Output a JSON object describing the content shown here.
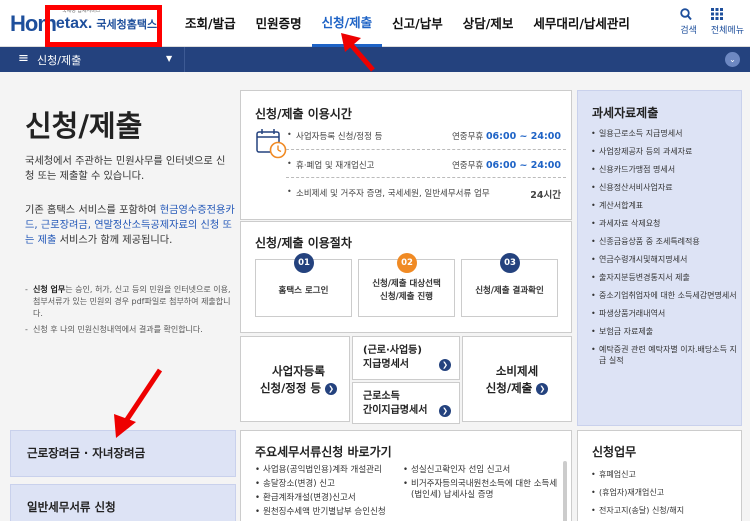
{
  "header": {
    "logo_home": "Hom",
    "logo_tax": "etax.",
    "logo_kr": "국세청홈택스",
    "logo_small": "국세청 납세서비스",
    "nav": [
      "조회/발급",
      "민원증명",
      "신청/제출",
      "신고/납부",
      "상담/제보",
      "세무대리/납세관리"
    ],
    "nav_active_index": 2,
    "search_label": "검색",
    "menu_label": "전체메뉴",
    "search_icon": "magnifier-icon",
    "menu_icon": "grid-icon"
  },
  "bar": {
    "title": "신청/제출",
    "home_icon": "hamburger-icon",
    "dropdown_icon": "triangle-down-icon",
    "right_icon": "chevron-down-icon"
  },
  "left": {
    "title": "신청/제출",
    "desc1": "국세청에서 주관하는 민원사무를 인터넷으로 신청 또는 제출할 수 있습니다.",
    "desc2_pre": "기존 홈택스 서비스를 포함하여 ",
    "desc2_link": "현금영수증전용카드, 근로장려금, 연말정산소득공제자료의 신청 또는 제출",
    "desc2_post": " 서비스가 함께 제공됩니다.",
    "note1_bold": "신청 업무",
    "note1": "는 승인, 허가, 신고 등의 민원을 인터넷으로 이용, 첨부서류가 있는 민원의 경우 pdf파일로 첨부하여 제출합니다.",
    "note2": "신청 후 나의 민원신청내역에서 결과를 확인합니다.",
    "btn1": "근로장려금 · 자녀장려금",
    "btn2": "일반세무서류 신청"
  },
  "hours": {
    "title": "신청/제출 이용시간",
    "rows": [
      {
        "k": "사업자등록 신청/정정 등",
        "v_pre": "연중무휴 ",
        "v": "06:00 ~ 24:00"
      },
      {
        "k": "휴·폐업 및 재개업신고",
        "v_pre": "연중무휴 ",
        "v": "06:00 ~ 24:00"
      },
      {
        "k": "소비제세 및 거주자 증명, 국세세원, 일반세무서류 업무",
        "v_pre": "",
        "v": "24시간"
      }
    ]
  },
  "steps": {
    "title": "신청/제출 이용절차",
    "items": [
      {
        "num": "01",
        "label": "홈택스 로그인",
        "color": "#24427e"
      },
      {
        "num": "02",
        "label1": "신청/제출 대상선택",
        "label2": "신청/제출 진행",
        "color": "#f08a24"
      },
      {
        "num": "03",
        "label": "신청/제출 결과확인",
        "color": "#24427e"
      }
    ]
  },
  "tiles": {
    "t1_line1": "사업자등록",
    "t1_line2": "신청/정정 등",
    "t2_line1": "(근로·사업등)",
    "t2_line2": "지급명세서",
    "t3_line1": "근로소득",
    "t3_line2": "간이지급명세서",
    "t4_line1": "소비제세",
    "t4_line2": "신청/제출"
  },
  "quick": {
    "title": "주요세무서류신청 바로가기",
    "col1": [
      "사업용(공익법인용)계좌 개설관리",
      "송달장소(변경) 신고",
      "환급계좌개설(변경)신고서",
      "원천징수세액 반기별납부 승인신청"
    ],
    "col2": [
      "성실신고확인자 선임 신고서",
      "비거주자등의국내원천소득에 대한 소득세(법인세) 납세사실 증명"
    ]
  },
  "submit": {
    "title": "과세자료제출",
    "items": [
      "일용근로소득 지급명세서",
      "사업장제공자 등의 과세자료",
      "신용카드가맹점 명세서",
      "신용정산서비사업자료",
      "계산서합계표",
      "과세자료 삭제요청",
      "신종금융상품 중 조세특례적용",
      "연금수령개시및해지명세서",
      "출자지분등변경통지서 제출",
      "중소기업취업자에 대한 소득세감면명세서",
      "파생상품거래내역서",
      "보험금 자료제출",
      "예탁증권 관련 예탁자별 이자.배당소득 지급 실적"
    ]
  },
  "work": {
    "title": "신청업무",
    "items": [
      "휴폐업신고",
      "(휴업자)재개업신고",
      "전자고지(송달) 신청/해지"
    ]
  }
}
